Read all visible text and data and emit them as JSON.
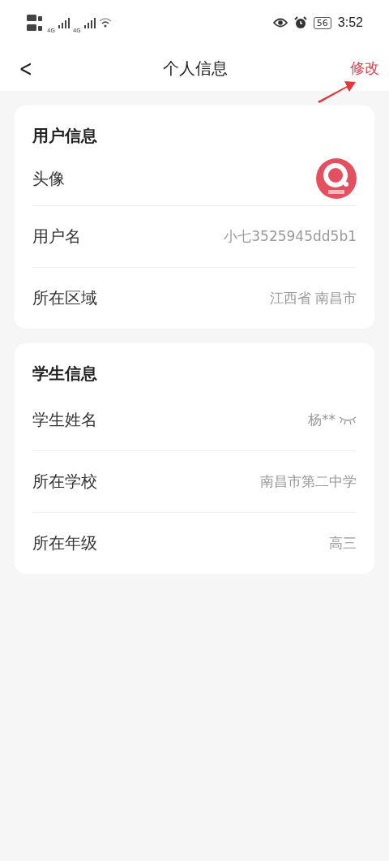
{
  "status_bar": {
    "network": [
      "4G",
      "4G"
    ],
    "battery": "56",
    "time": "3:52"
  },
  "header": {
    "back": "<",
    "title": "个人信息",
    "action": "修改"
  },
  "sections": [
    {
      "title": "用户信息",
      "rows": [
        {
          "kind": "avatar",
          "label": "头像"
        },
        {
          "kind": "text",
          "label": "用户名",
          "value": "小七3525945dd5b1"
        },
        {
          "kind": "text",
          "label": "所在区域",
          "value": "江西省 南昌市"
        }
      ]
    },
    {
      "title": "学生信息",
      "rows": [
        {
          "kind": "masked",
          "label": "学生姓名",
          "value": "杨**"
        },
        {
          "kind": "text",
          "label": "所在学校",
          "value": "南昌市第二中学"
        },
        {
          "kind": "text",
          "label": "所在年级",
          "value": "高三"
        }
      ]
    }
  ]
}
